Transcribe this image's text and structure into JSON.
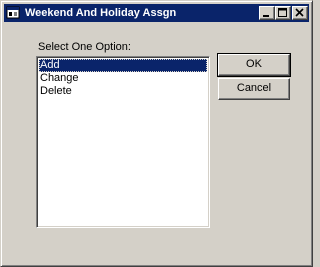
{
  "window": {
    "title": "Weekend And Holiday Assgn",
    "icon": "app-window-icon",
    "controls": [
      "minimize-icon",
      "maximize-icon",
      "close-icon"
    ]
  },
  "dialog": {
    "prompt_label": "Select One Option:",
    "options": [
      {
        "label": "Add",
        "selected": true
      },
      {
        "label": "Change",
        "selected": false
      },
      {
        "label": "Delete",
        "selected": false
      }
    ],
    "ok_label": "OK",
    "cancel_label": "Cancel"
  },
  "colors": {
    "title_bar": "#0a246a",
    "face": "#d4d0c8",
    "selection": "#0a246a"
  }
}
